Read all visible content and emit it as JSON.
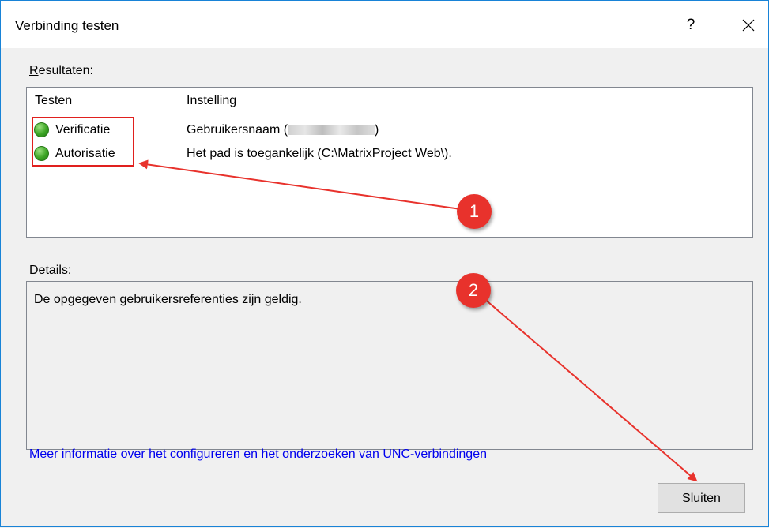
{
  "window": {
    "title": "Verbinding testen",
    "help_label": "?",
    "close_icon": "close-icon"
  },
  "results": {
    "label_prefix": "R",
    "label_rest": "esultaten:",
    "columns": [
      "Testen",
      "Instelling"
    ],
    "rows": [
      {
        "test": "Verificatie",
        "setting": "Gebruikersnaam (",
        "setting_tail": ")",
        "status_icon": "check-icon"
      },
      {
        "test": "Autorisatie",
        "setting": "Het pad is toegankelijk (C:\\MatrixProject Web\\).",
        "setting_tail": "",
        "status_icon": "check-icon"
      }
    ]
  },
  "details": {
    "label": "Details:",
    "text": "De opgegeven gebruikersreferenties zijn geldig."
  },
  "link": {
    "text": "Meer informatie over het configureren en het onderzoeken van UNC-verbindingen"
  },
  "buttons": {
    "close_label": "Sluiten"
  },
  "annotations": {
    "badge_1": "1",
    "badge_2": "2",
    "color": "#e8322c"
  }
}
